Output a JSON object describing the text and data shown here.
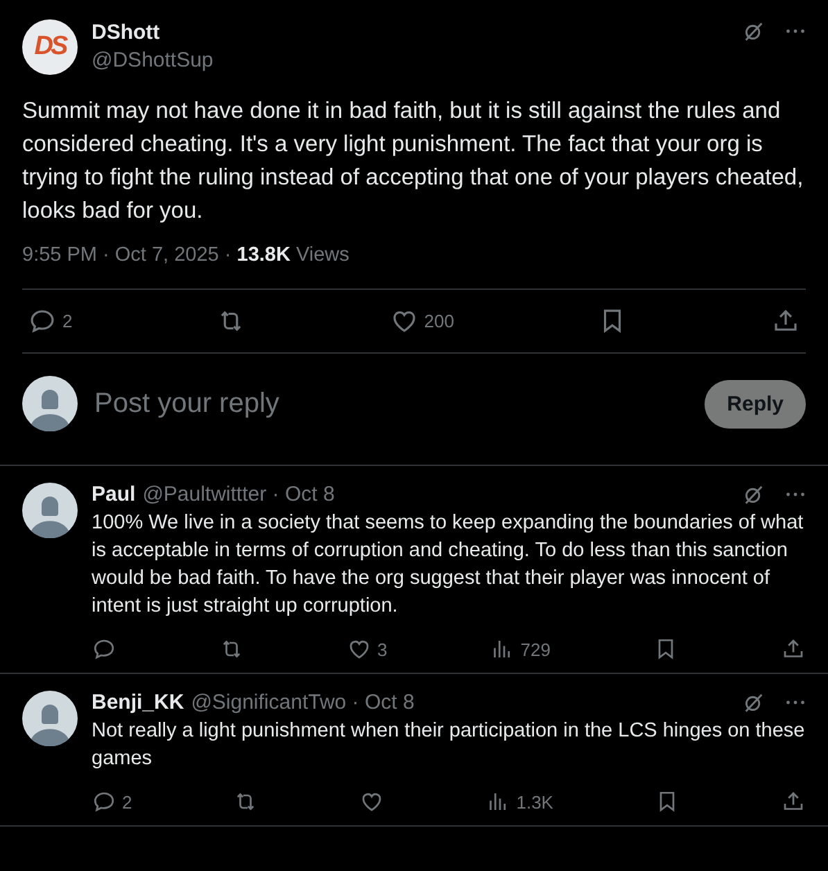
{
  "post": {
    "avatar_text": "DS",
    "name": "DShott",
    "handle": "@DShottSup",
    "text": "Summit may not have done it in bad faith, but it is still against the rules and considered cheating.  It's a very light punishment.  The fact that your org is trying to fight the ruling instead of accepting that one of your players cheated, looks bad for you.",
    "stamp": "9:55 PM · Oct 7, 2025 · **13.8K** Views",
    "actions": [
      {
        "kind": "reply",
        "count": "2"
      },
      {
        "kind": "repost"
      },
      {
        "kind": "like",
        "count": "200"
      },
      {
        "kind": "bookmark"
      },
      {
        "kind": "share"
      }
    ]
  },
  "composer": {
    "placeholder": "Post your reply",
    "button": "Reply"
  },
  "replies": [
    {
      "name": "Paul",
      "handle": "@Paultwittter · Oct 8",
      "text": "100% We live in a society that seems to keep expanding the boundaries of what is acceptable in terms of corruption and cheating. To do less than this sanction would be bad faith. To have the org suggest that their player was innocent of intent is just straight up corruption.",
      "actions": [
        {
          "kind": "reply"
        },
        {
          "kind": "repost"
        },
        {
          "kind": "like",
          "count": "3"
        },
        {
          "kind": "views",
          "count": "729"
        },
        {
          "kind": "bookmark"
        },
        {
          "kind": "share"
        }
      ]
    },
    {
      "name": "Benji_KK",
      "handle": "@SignificantTwo · Oct 8",
      "text": "Not really a light punishment when their participation in the LCS hinges on these games",
      "actions": [
        {
          "kind": "reply",
          "count": "2"
        },
        {
          "kind": "repost"
        },
        {
          "kind": "like"
        },
        {
          "kind": "views",
          "count": "1.3K"
        },
        {
          "kind": "bookmark"
        },
        {
          "kind": "share"
        }
      ]
    }
  ]
}
